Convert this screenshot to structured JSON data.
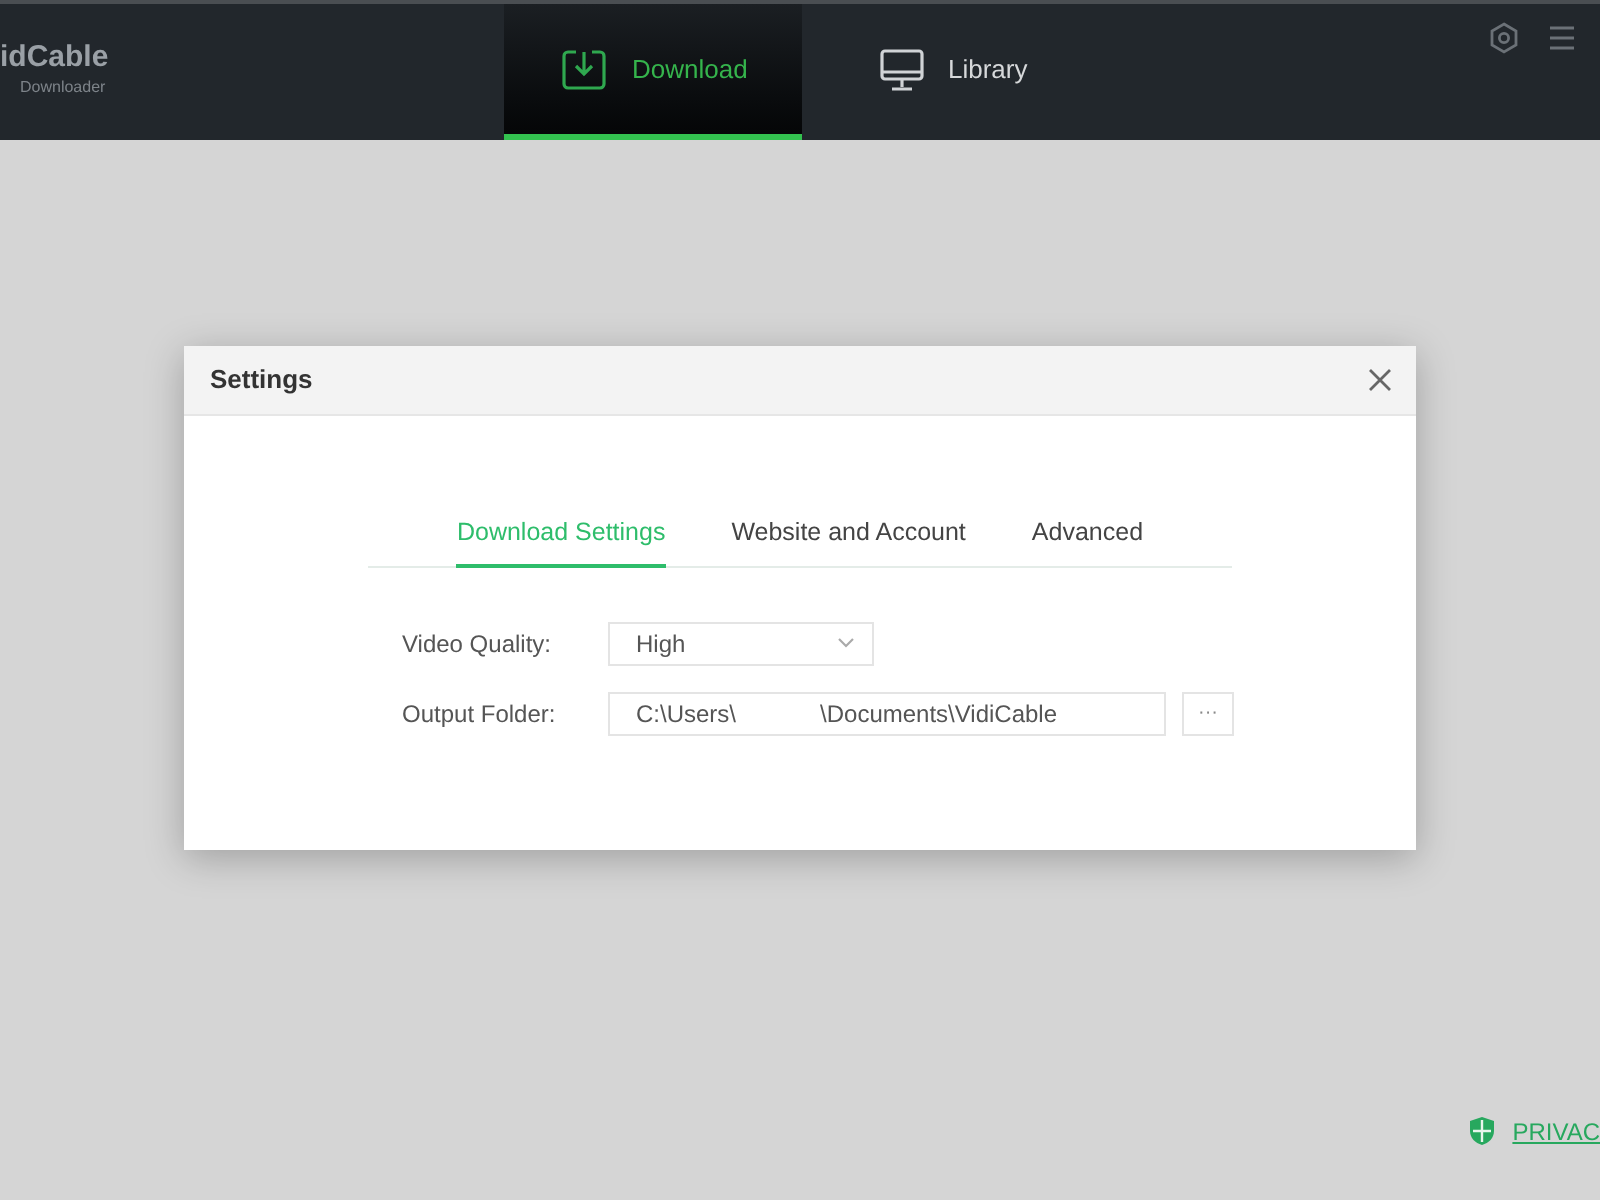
{
  "app": {
    "logo_title": "idCable",
    "logo_subtitle": "Downloader"
  },
  "nav_tabs": [
    {
      "label": "Download",
      "selected": true
    },
    {
      "label": "Library",
      "selected": false
    }
  ],
  "dialog": {
    "title": "Settings",
    "tabs": [
      {
        "label": "Download Settings",
        "selected": true
      },
      {
        "label": "Website and Account",
        "selected": false
      },
      {
        "label": "Advanced",
        "selected": false
      }
    ],
    "fields": [
      {
        "kind": "select",
        "label": "Video Quality:",
        "value": "High"
      },
      {
        "kind": "path",
        "label": "Output Folder:",
        "value_start": "C:\\Users\\",
        "value_end": "\\Documents\\VidiCable",
        "button": "···"
      }
    ]
  },
  "footer": {
    "privacy_link": "PRIVAC"
  }
}
